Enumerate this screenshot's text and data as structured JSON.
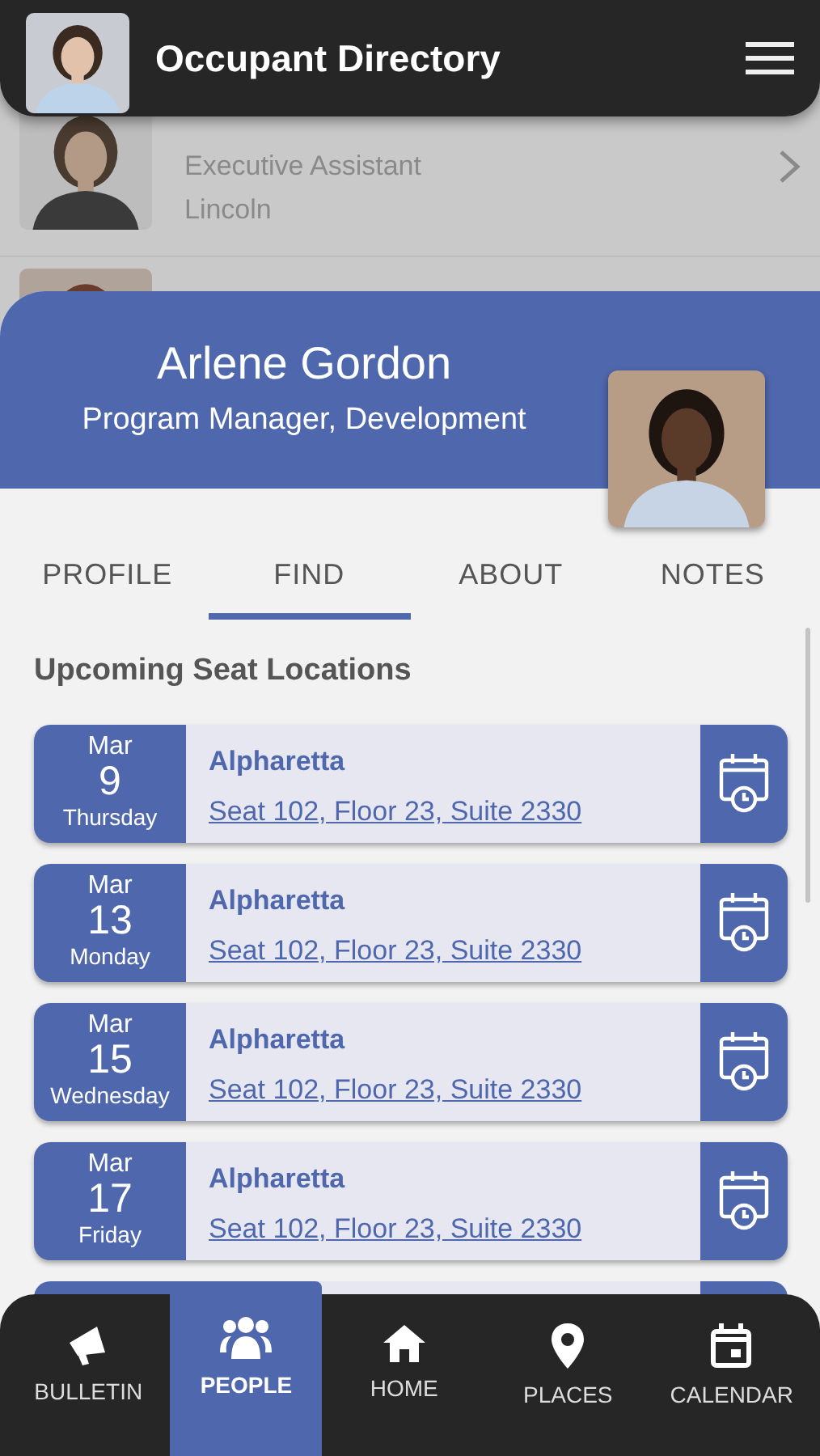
{
  "app_bar": {
    "title": "Occupant Directory"
  },
  "background_list": [
    {
      "title": "Executive Assistant",
      "location": "Lincoln"
    }
  ],
  "profile": {
    "name": "Arlene Gordon",
    "role": "Program Manager, Development"
  },
  "tabs": [
    {
      "label": "PROFILE",
      "selected": false
    },
    {
      "label": "FIND",
      "selected": true
    },
    {
      "label": "ABOUT",
      "selected": false
    },
    {
      "label": "NOTES",
      "selected": false
    }
  ],
  "section_title": "Upcoming Seat Locations",
  "seat_locations": [
    {
      "kind": "full",
      "month": "Mar",
      "day": "9",
      "weekday": "Thursday",
      "place": "Alpharetta",
      "seat": "Seat 102, Floor 23, Suite 2330"
    },
    {
      "kind": "full",
      "month": "Mar",
      "day": "13",
      "weekday": "Monday",
      "place": "Alpharetta",
      "seat": "Seat 102, Floor 23, Suite 2330"
    },
    {
      "kind": "full",
      "month": "Mar",
      "day": "15",
      "weekday": "Wednesday",
      "place": "Alpharetta",
      "seat": "Seat 102, Floor 23, Suite 2330"
    },
    {
      "kind": "full",
      "month": "Mar",
      "day": "17",
      "weekday": "Friday",
      "place": "Alpharetta",
      "seat": "Seat 102, Floor 23, Suite 2330"
    },
    {
      "kind": "partial"
    }
  ],
  "bottom_nav": [
    {
      "kind": "bulletin",
      "label": "BULLETIN",
      "selected": false
    },
    {
      "kind": "people",
      "label": "PEOPLE",
      "selected": true
    },
    {
      "kind": "home",
      "label": "HOME",
      "selected": false
    },
    {
      "kind": "places",
      "label": "PLACES",
      "selected": false
    },
    {
      "kind": "calendar",
      "label": "CALENDAR",
      "selected": false
    }
  ]
}
